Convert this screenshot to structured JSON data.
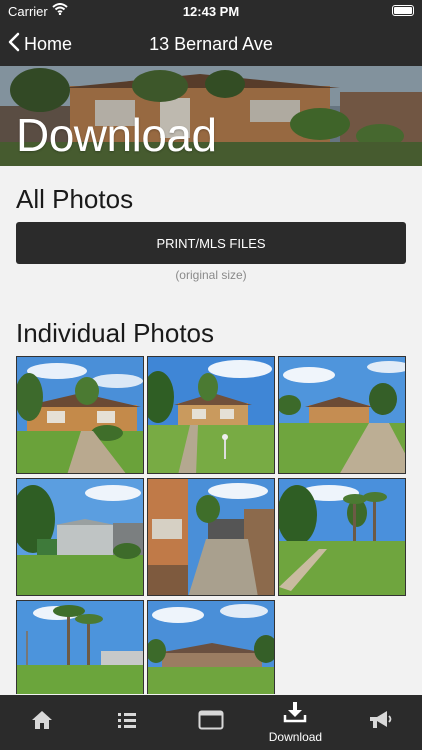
{
  "status": {
    "carrier": "Carrier",
    "time": "12:43 PM"
  },
  "nav": {
    "back_label": "Home",
    "title": "13 Bernard Ave"
  },
  "hero": {
    "title": "Download"
  },
  "all_photos": {
    "heading": "All Photos",
    "button": "PRINT/MLS FILES",
    "caption": "(original size)"
  },
  "individual": {
    "heading": "Individual Photos"
  },
  "photos": [
    {
      "icon": "house-photo"
    },
    {
      "icon": "house-photo"
    },
    {
      "icon": "house-photo"
    },
    {
      "icon": "yard-photo"
    },
    {
      "icon": "side-path-photo"
    },
    {
      "icon": "garden-photo"
    },
    {
      "icon": "backyard-photo"
    },
    {
      "icon": "backyard-photo"
    }
  ],
  "tabs": [
    {
      "icon": "home-icon",
      "label": ""
    },
    {
      "icon": "list-icon",
      "label": ""
    },
    {
      "icon": "browser-icon",
      "label": ""
    },
    {
      "icon": "download-icon",
      "label": "Download"
    },
    {
      "icon": "megaphone-icon",
      "label": ""
    }
  ],
  "colors": {
    "bar": "#2b2b2b",
    "background": "#f2f2f2",
    "sky": "#4a8fd8",
    "grass": "#6aa23a",
    "brick": "#c48a4a"
  }
}
